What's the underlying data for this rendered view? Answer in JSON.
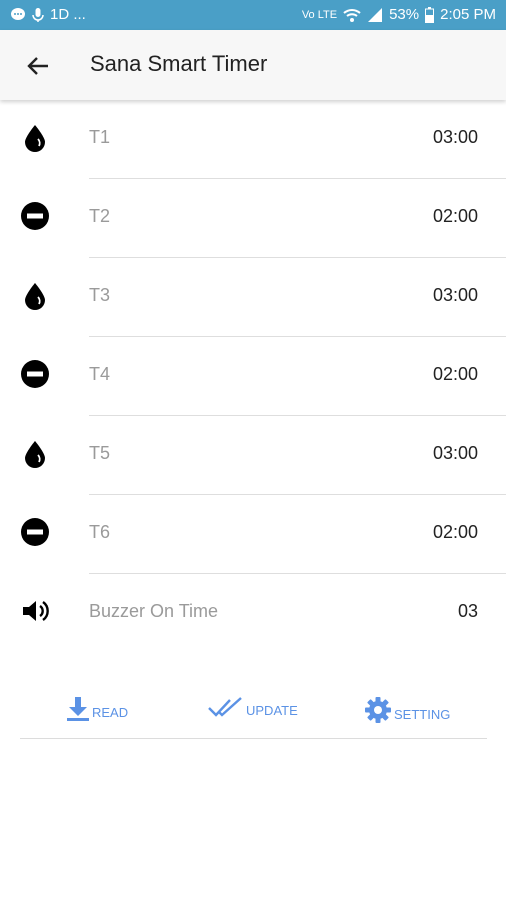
{
  "status_bar": {
    "left_text": "1D ...",
    "battery": "53%",
    "time": "2:05 PM",
    "icons": [
      "chat-icon",
      "mic-icon",
      "volte-icon",
      "wifi-icon",
      "signal-icon",
      "battery-icon"
    ]
  },
  "app_bar": {
    "title": "Sana Smart Timer",
    "back_icon": "arrow-left-icon"
  },
  "timers": [
    {
      "label": "T1",
      "value": "03:00",
      "icon": "water-drop-icon"
    },
    {
      "label": "T2",
      "value": "02:00",
      "icon": "minus-circle-icon"
    },
    {
      "label": "T3",
      "value": "03:00",
      "icon": "water-drop-icon"
    },
    {
      "label": "T4",
      "value": "02:00",
      "icon": "minus-circle-icon"
    },
    {
      "label": "T5",
      "value": "03:00",
      "icon": "water-drop-icon"
    },
    {
      "label": "T6",
      "value": "02:00",
      "icon": "minus-circle-icon"
    }
  ],
  "buzzer": {
    "label": "Buzzer On Time",
    "value": "03",
    "icon": "speaker-icon"
  },
  "actions": {
    "read": "READ",
    "update": "UPDATE",
    "setting": "SETTING"
  },
  "colors": {
    "status_bar": "#4a9fc7",
    "accent": "#5b92e5"
  }
}
